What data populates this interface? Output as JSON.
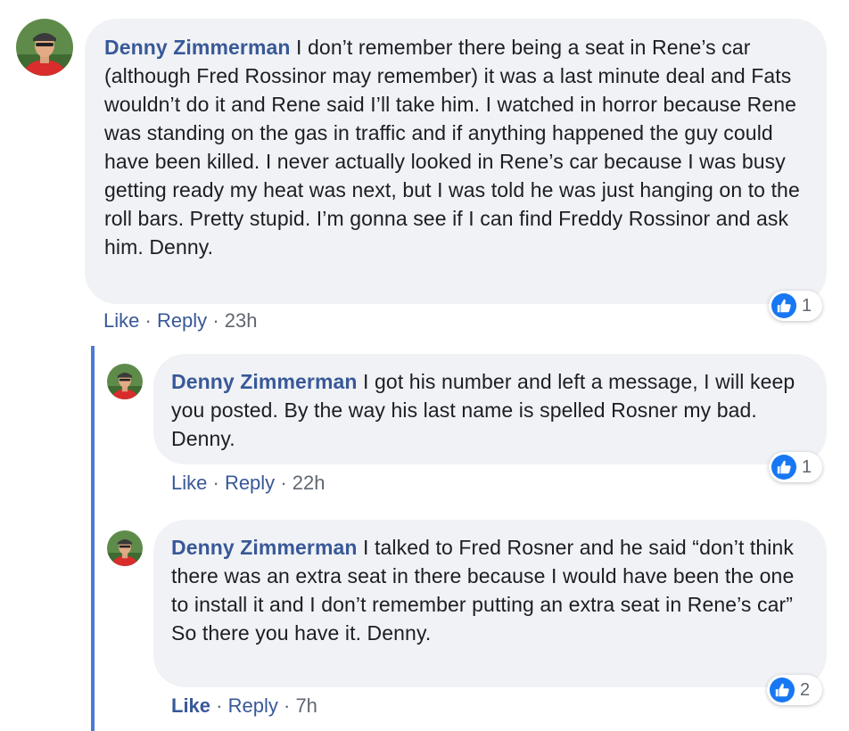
{
  "colors": {
    "author": "#385898",
    "bubble": "#f0f2f5",
    "meta": "#606770",
    "like_blue": "#1877f2",
    "thread_line": "#4b7bd6"
  },
  "comments": [
    {
      "author": "Denny Zimmerman",
      "text": " I don’t remember there being a seat in Rene’s car (although Fred Rossinor may remember) it was a last minute deal and Fats wouldn’t do it and Rene said I’ll take him. I watched in horror because Rene was standing on the gas in traffic and if anything happened the guy could have been killed. I never actually looked in Rene’s car because I was busy getting ready my heat was next, but I was told he was just hanging on to the roll bars. Pretty stupid. I’m gonna see if I can find Freddy Rossinor and ask him. Denny.",
      "like_label": "Like",
      "reply_label": "Reply",
      "time": "23h",
      "reaction_icon": "like-icon",
      "reaction_count": "1"
    },
    {
      "author": "Denny Zimmerman",
      "text": " I got his number and left a message, I will keep you posted. By the way his last name is spelled Rosner my bad. Denny.",
      "like_label": "Like",
      "reply_label": "Reply",
      "time": "22h",
      "reaction_icon": "like-icon",
      "reaction_count": "1"
    },
    {
      "author": "Denny Zimmerman",
      "text": " I talked to Fred Rosner and he said “don’t think there was an extra seat in there because I would have been the one to install it and I don’t remember putting an extra seat in Rene’s car” So there you have it. Denny.",
      "like_label": "Like",
      "reply_label": "Reply",
      "time": "7h",
      "reaction_icon": "like-icon",
      "reaction_count": "2"
    }
  ],
  "separator": "·"
}
